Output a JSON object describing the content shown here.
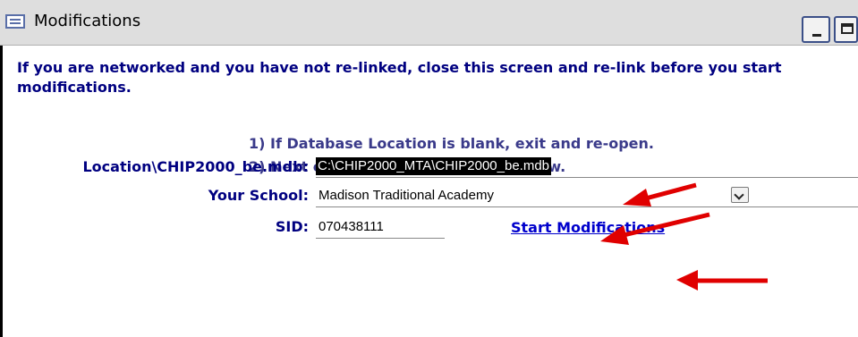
{
  "window": {
    "title": "Modifications",
    "icon": "form-icon"
  },
  "notice": {
    "warning": "If you are networked and you have not re-linked, close this screen and re-link before you start modifications.",
    "step1": "1)  If Database Location is blank, exit and re-open.",
    "step2": "2)  Next click Start Modifications below."
  },
  "form": {
    "location_label": "Location\\CHIP2000_be.mdb:",
    "location_value": "C:\\CHIP2000_MTA\\CHIP2000_be.mdb",
    "school_label": "Your School:",
    "school_value": "Madison Traditional Academy",
    "sid_label": "SID:",
    "sid_value": "070438111",
    "start_label": "Start Modifications"
  },
  "annotations": {
    "arrow_color": "#e00000",
    "arrows": [
      "location-arrow",
      "school-arrow",
      "start-modifications-arrow"
    ]
  }
}
